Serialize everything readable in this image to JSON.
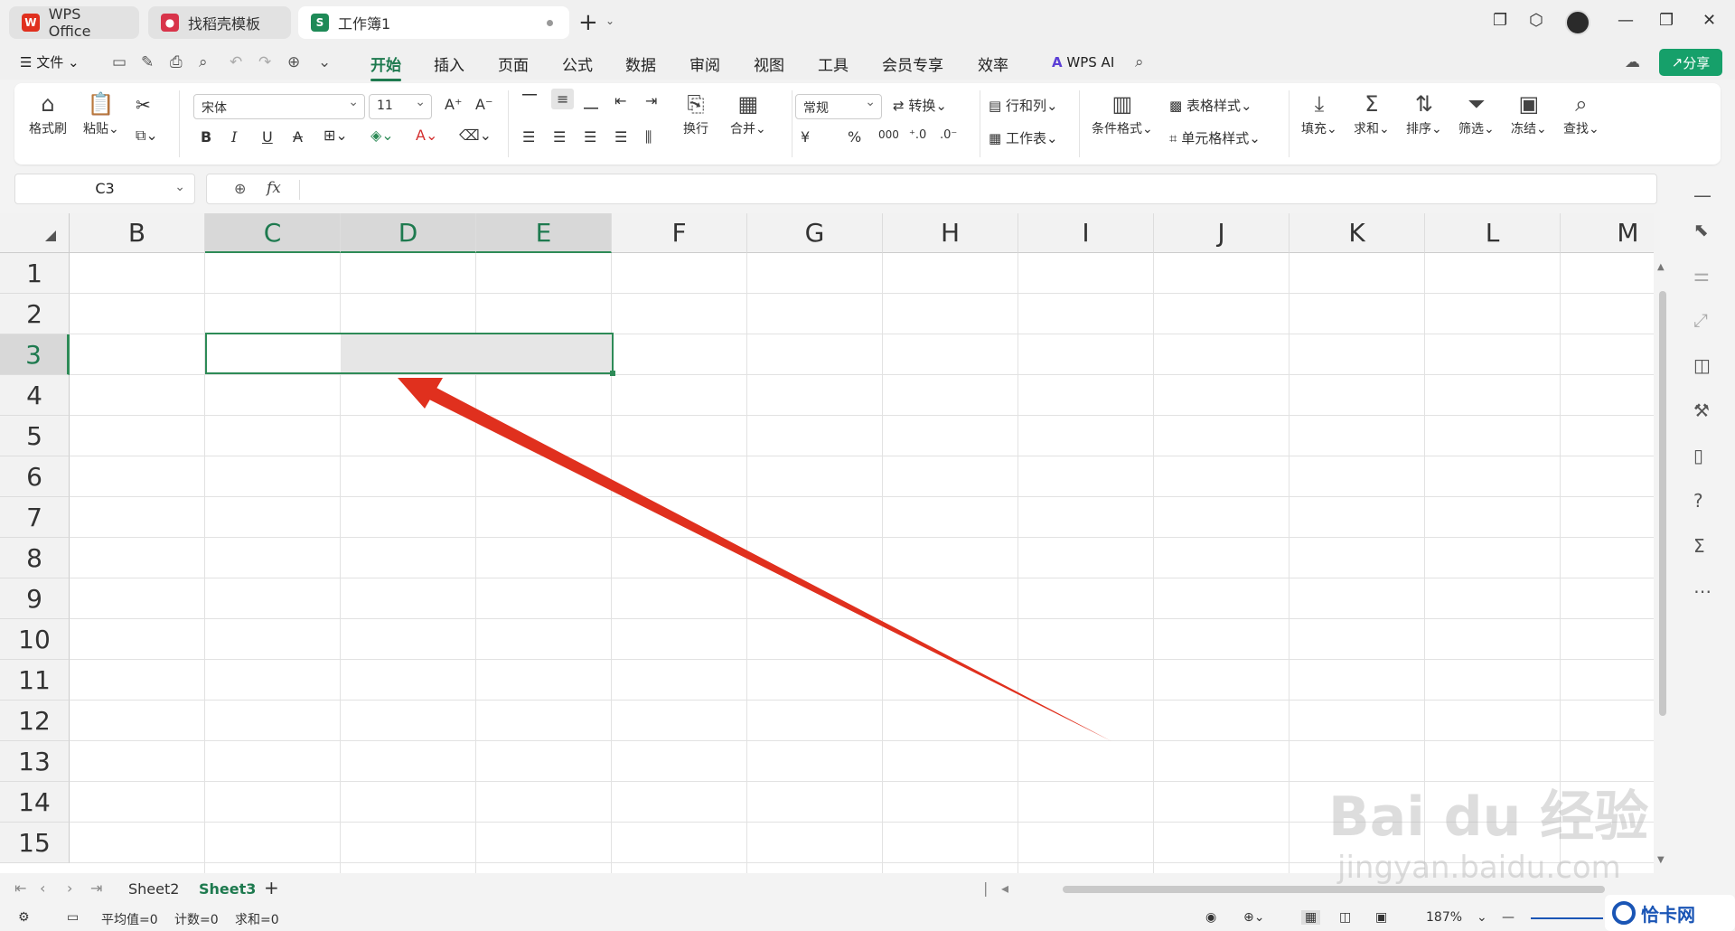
{
  "tabs": [
    {
      "label": "WPS Office",
      "icon": "W"
    },
    {
      "label": "找稻壳模板",
      "icon": "●"
    },
    {
      "label": "工作簿1",
      "icon": "S"
    }
  ],
  "menu": {
    "file": "文件",
    "items": [
      "开始",
      "插入",
      "页面",
      "公式",
      "数据",
      "审阅",
      "视图",
      "工具",
      "会员专享",
      "效率"
    ],
    "ai": "WPS AI",
    "share": "分享"
  },
  "ribbon": {
    "format_painter": "格式刷",
    "paste": "粘贴",
    "font": "宋体",
    "size": "11",
    "wrap": "换行",
    "merge": "合并",
    "number_format": "常规",
    "convert": "转换",
    "rowcol": "行和列",
    "worksheet": "工作表",
    "cond_format": "条件格式",
    "table_style": "表格样式",
    "cell_style": "单元格样式",
    "fill": "填充",
    "sum": "求和",
    "sort": "排序",
    "filter": "筛选",
    "freeze": "冻结",
    "find": "查找",
    "bold": "B",
    "italic": "I",
    "underline": "U",
    "strike": "A",
    "currency": "¥",
    "percent": "%",
    "thousand": "000"
  },
  "namebox": "C3",
  "fx": "fx",
  "columns": [
    "B",
    "C",
    "D",
    "E",
    "F",
    "G",
    "H",
    "I",
    "J",
    "K",
    "L",
    "M"
  ],
  "rows": [
    "1",
    "2",
    "3",
    "4",
    "5",
    "6",
    "7",
    "8",
    "9",
    "10",
    "11",
    "12",
    "13",
    "14",
    "15"
  ],
  "sheets": [
    "Sheet2",
    "Sheet3"
  ],
  "status": {
    "average": "平均值=0",
    "count": "计数=0",
    "sum": "求和=0",
    "zoom": "187%"
  },
  "watermark": {
    "main": "Bai du 经验",
    "url": "jingyan.baidu.com",
    "site": "恰卡网"
  },
  "colors": {
    "accent": "#1e7a4f",
    "share": "#16a06a",
    "arrow": "#e0301e"
  }
}
